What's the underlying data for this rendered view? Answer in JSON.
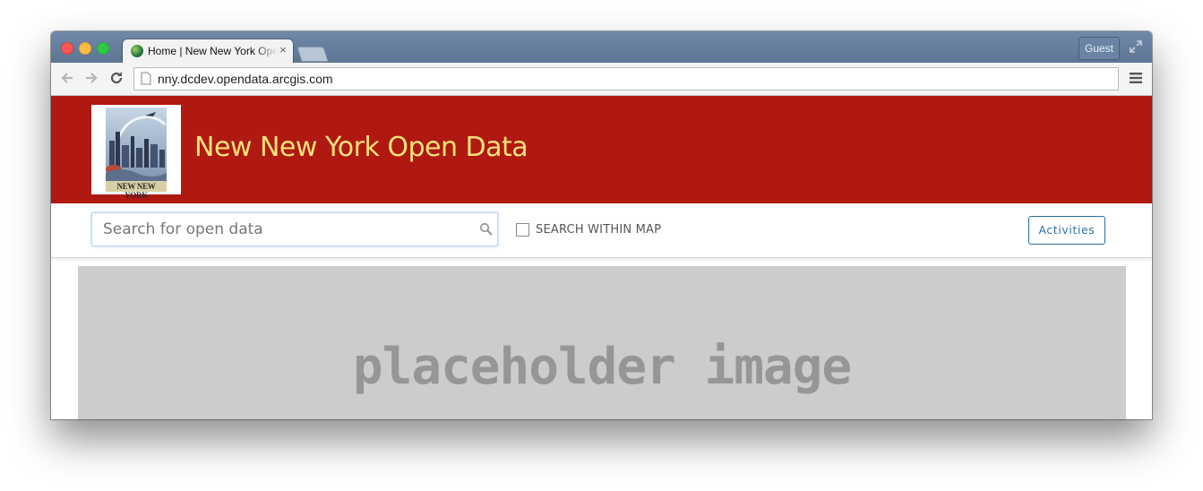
{
  "browser": {
    "tab": {
      "title": "Home | New New York Open Data",
      "close_glyph": "×"
    },
    "guest_label": "Guest",
    "url": "nny.dcdev.opendata.arcgis.com",
    "icons": [
      "back-arrow-icon",
      "forward-arrow-icon",
      "reload-icon",
      "page-icon",
      "menu-icon",
      "fullscreen-icon",
      "globe-favicon-icon"
    ]
  },
  "site": {
    "title": "New New York Open Data",
    "header_color": "#b01812",
    "title_color": "#f9e27a",
    "logo": {
      "caption": "NEW NEW YORK"
    }
  },
  "search": {
    "placeholder": "Search for open data",
    "within_map_label": "SEARCH WITHIN MAP",
    "within_map_checked": false
  },
  "activities_label": "Activities",
  "hero": {
    "text": "placeholder image"
  }
}
